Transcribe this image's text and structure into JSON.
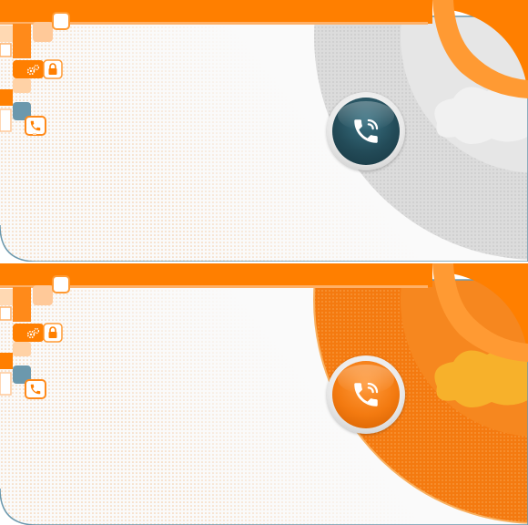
{
  "panels": [
    {
      "state": "default",
      "accent": "#ff7f00",
      "disc_color": "#d9d9d9",
      "button_color": "#2b5968",
      "icons": [
        "gears-icon",
        "lock-icon",
        "phone-icon"
      ]
    },
    {
      "state": "active",
      "accent": "#ff7f00",
      "disc_color": "#f47a10",
      "button_color": "#f37a10",
      "icons": [
        "gears-icon",
        "lock-icon",
        "phone-icon"
      ]
    }
  ]
}
